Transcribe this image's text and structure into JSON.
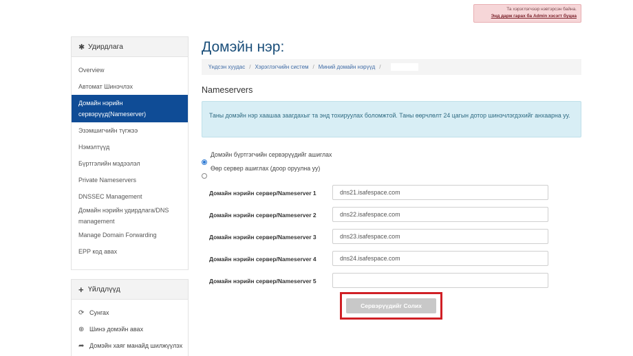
{
  "admin_notice": {
    "line1": "Та хэрэглэгчээр нэвтэрсэн байна.",
    "line2": "Энд дарж гарах ба Admin хэсэгт буцна"
  },
  "sidebar": {
    "manage_title": "Удирдлага",
    "manage_icon": "gear-icon",
    "items": [
      {
        "label": "Overview"
      },
      {
        "label": "Автомат Шинэчлэх"
      },
      {
        "label": "Домайн нэрийн сервэрүүд(Nameserver)",
        "active": true
      },
      {
        "label": "Эзэмшигчийн түгжээ"
      },
      {
        "label": "Нэмэлтүүд"
      },
      {
        "label": "Бүртгэлийн мэдээлэл"
      },
      {
        "label": "Private Nameservers"
      },
      {
        "label": "DNSSEC Management"
      },
      {
        "label": "Домайн нэрийн удирдлага/DNS management"
      },
      {
        "label": "Manage Domain Forwarding"
      },
      {
        "label": "EPP код авах"
      }
    ],
    "actions_title": "Үйлдлүүд",
    "actions_icon": "plus-icon",
    "actions": [
      {
        "label": "Сунгах",
        "icon": "refresh-icon"
      },
      {
        "label": "Шинэ домэйн авах",
        "icon": "globe-icon"
      },
      {
        "label": "Домэйн хаяг манайд шилжүүлэх",
        "icon": "share-icon"
      }
    ]
  },
  "main": {
    "title": "Домэйн нэр:",
    "breadcrumb": [
      "Үндсэн хуудас",
      "Хэрэглэгчийн систем",
      "Миний домайн нэрүүд"
    ],
    "section_title": "Nameservers",
    "info": "Таны домэйн нэр хаашаа заагдахыг та энд тохируулах боломжтой. Таны өөрчлөлт 24 цагын дотор шинэчлэгдэхийг анхаарна уу.",
    "options": [
      {
        "label": "Домэйн бүртгэгчийн сервэрүүдийг ашиглах",
        "checked": true
      },
      {
        "label": "Өөр сервер ашиглах (доор оруулна уу)",
        "checked": false
      }
    ],
    "nameservers": [
      {
        "label": "Домайн нэрийн сервер/Nameserver 1",
        "value": "dns21.isafespace.com"
      },
      {
        "label": "Домайн нэрийн сервер/Nameserver 2",
        "value": "dns22.isafespace.com"
      },
      {
        "label": "Домайн нэрийн сервер/Nameserver 3",
        "value": "dns23.isafespace.com"
      },
      {
        "label": "Домайн нэрийн сервер/Nameserver 4",
        "value": "dns24.isafespace.com"
      },
      {
        "label": "Домайн нэрийн сервер/Nameserver 5",
        "value": ""
      }
    ],
    "submit_label": "Сервэрүүдийг Солих"
  },
  "colors": {
    "accent": "#0f4c96",
    "title": "#1b4f7a",
    "highlight_border": "#d01f25",
    "info_bg": "#d8eef5"
  }
}
